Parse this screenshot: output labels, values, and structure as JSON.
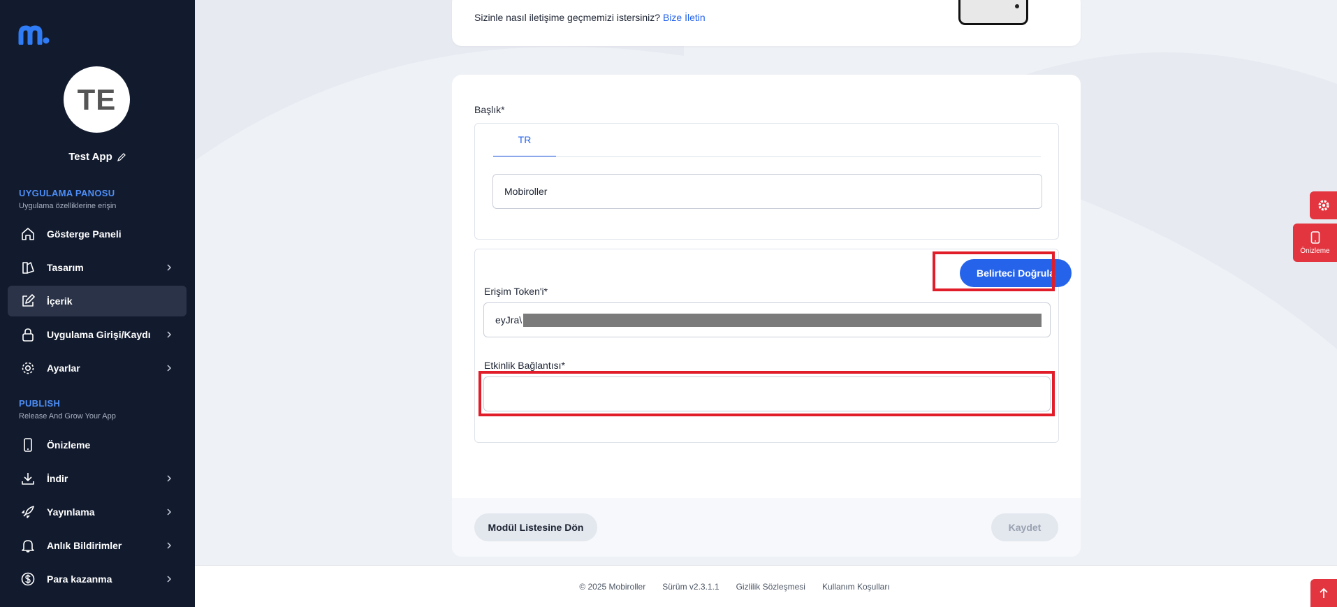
{
  "sidebar": {
    "avatar_initials": "TE",
    "app_name": "Test App",
    "section_dashboard": {
      "title": "UYGULAMA PANOSU",
      "subtitle": "Uygulama özelliklerine erişin"
    },
    "items_top": [
      {
        "label": "Gösterge Paneli",
        "icon": "home-icon",
        "chevron": false
      },
      {
        "label": "Tasarım",
        "icon": "design-icon",
        "chevron": true
      },
      {
        "label": "İçerik",
        "icon": "edit-icon",
        "chevron": false,
        "active": true
      },
      {
        "label": "Uygulama Girişi/Kaydı",
        "icon": "lock-icon",
        "chevron": true
      },
      {
        "label": "Ayarlar",
        "icon": "gear-icon",
        "chevron": true
      }
    ],
    "section_publish": {
      "title": "PUBLISH",
      "subtitle": "Release And Grow Your App"
    },
    "items_bottom": [
      {
        "label": "Önizleme",
        "icon": "phone-icon",
        "chevron": false
      },
      {
        "label": "İndir",
        "icon": "download-icon",
        "chevron": true
      },
      {
        "label": "Yayınlama",
        "icon": "rocket-icon",
        "chevron": true
      },
      {
        "label": "Anlık Bildirimler",
        "icon": "bell-icon",
        "chevron": true
      },
      {
        "label": "Para kazanma",
        "icon": "dollar-icon",
        "chevron": true
      }
    ]
  },
  "contact": {
    "question": "Sizinle nasıl iletişime geçmemizi istersiniz?",
    "link": "Bize İletin"
  },
  "form": {
    "title_label": "Başlık*",
    "tab_label": "TR",
    "title_value": "Mobiroller",
    "verify_button": "Belirteci Doğrula",
    "token_label": "Erişim Token'i*",
    "token_value": "eyJra\\",
    "event_link_label": "Etkinlik Bağlantısı*",
    "event_link_value": "",
    "back_button": "Modül Listesine Dön",
    "save_button": "Kaydet"
  },
  "footer": {
    "copyright": "© 2025 Mobiroller",
    "version": "Sürüm v2.3.1.1",
    "privacy": "Gizlilik Sözleşmesi",
    "terms": "Kullanım Koşulları"
  },
  "side_widgets": {
    "preview_label": "Önizleme"
  },
  "colors": {
    "sidebar_bg": "#121b2e",
    "accent": "#2563eb",
    "highlight": "#e11d2a",
    "widget_red": "#e2353f"
  }
}
